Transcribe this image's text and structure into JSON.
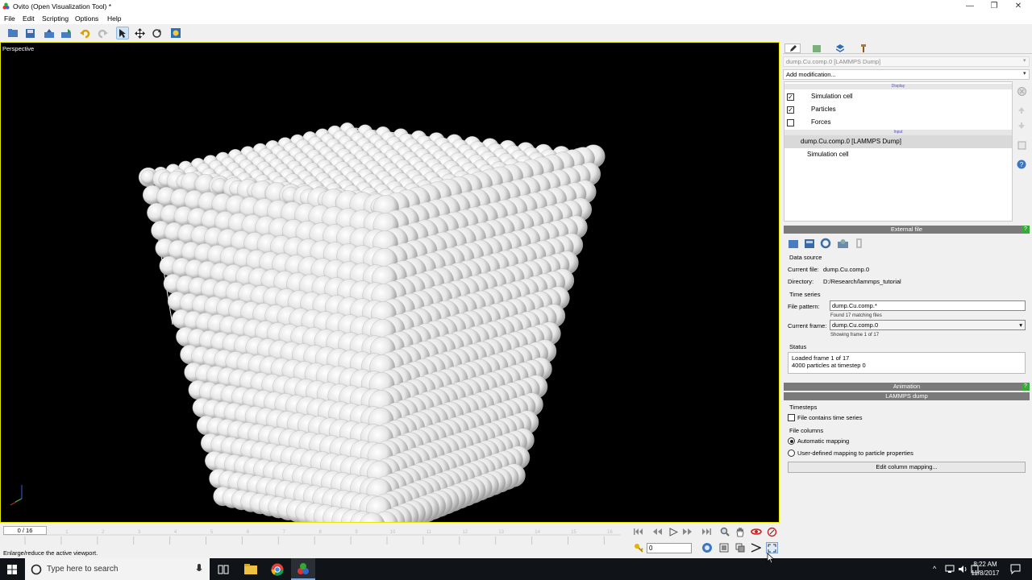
{
  "window": {
    "title": "Ovito (Open Visualization Tool) *",
    "min": "—",
    "max": "❐",
    "close": "✕"
  },
  "menu": [
    "File",
    "Edit",
    "Scripting",
    "Options",
    "Help"
  ],
  "viewport": {
    "label": "Perspective"
  },
  "timeline": {
    "frame_display": "0 / 16",
    "ticks": [
      "0",
      "1",
      "2",
      "3",
      "4",
      "5",
      "6",
      "7",
      "8",
      "9",
      "10",
      "11",
      "12",
      "13",
      "14",
      "15",
      "16"
    ]
  },
  "status_message": "Enlarge/reduce the active viewport.",
  "animation": {
    "spinner_value": "0"
  },
  "pipeline": {
    "selector": "dump.Cu.comp.0 [LAMMPS Dump]",
    "add_modification": "Add modification...",
    "display_header": "Display",
    "input_header": "Input",
    "display_items": [
      {
        "label": "Simulation cell",
        "checked": true
      },
      {
        "label": "Particles",
        "checked": true
      },
      {
        "label": "Forces",
        "checked": false
      }
    ],
    "input_items": [
      "dump.Cu.comp.0 [LAMMPS Dump]",
      "Simulation cell"
    ]
  },
  "external_file": {
    "header": "External file",
    "help": "?",
    "data_source": "Data source",
    "current_file_label": "Current file:",
    "current_file": "dump.Cu.comp.0",
    "directory_label": "Directory:",
    "directory": "D:/Research/lammps_tutorial",
    "time_series": "Time series",
    "file_pattern_label": "File pattern:",
    "file_pattern": "dump.Cu.comp.*",
    "found_files": "Found 17 matching files",
    "current_frame_label": "Current frame:",
    "current_frame": "dump.Cu.comp.0",
    "showing_frame": "Showing frame 1 of 17",
    "status_label": "Status",
    "status_lines": [
      "Loaded frame 1 of 17",
      "4000 particles at timestep 0"
    ]
  },
  "animation_rollout": {
    "header": "Animation",
    "help": "?"
  },
  "lammps_dump": {
    "header": "LAMMPS dump",
    "timesteps_label": "Timesteps",
    "file_contains_ts": "File contains time series",
    "file_columns_label": "File columns",
    "auto_mapping": "Automatic mapping",
    "user_mapping": "User-defined mapping to particle properties",
    "edit_button": "Edit column mapping..."
  },
  "taskbar": {
    "search_placeholder": "Type here to search",
    "time": "8:22 AM",
    "date": "11/8/2017"
  }
}
